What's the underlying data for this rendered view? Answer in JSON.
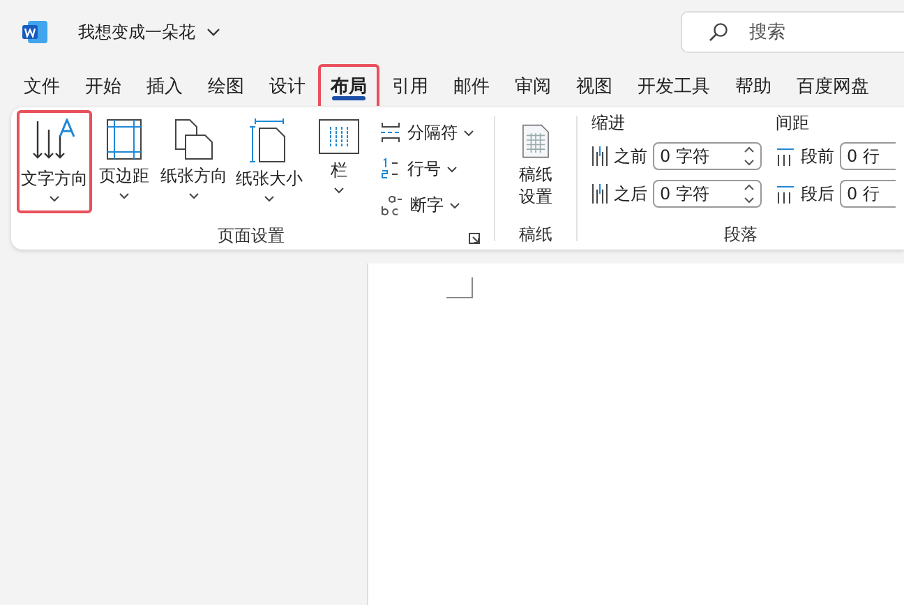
{
  "title_bar": {
    "document_title": "我想变成一朵花",
    "search": {
      "placeholder": "搜索"
    }
  },
  "tabs": [
    {
      "label": "文件",
      "selected": false,
      "highlighted": false
    },
    {
      "label": "开始",
      "selected": false,
      "highlighted": false
    },
    {
      "label": "插入",
      "selected": false,
      "highlighted": false
    },
    {
      "label": "绘图",
      "selected": false,
      "highlighted": false
    },
    {
      "label": "设计",
      "selected": false,
      "highlighted": false
    },
    {
      "label": "布局",
      "selected": true,
      "highlighted": true
    },
    {
      "label": "引用",
      "selected": false,
      "highlighted": false
    },
    {
      "label": "邮件",
      "selected": false,
      "highlighted": false
    },
    {
      "label": "审阅",
      "selected": false,
      "highlighted": false
    },
    {
      "label": "视图",
      "selected": false,
      "highlighted": false
    },
    {
      "label": "开发工具",
      "selected": false,
      "highlighted": false
    },
    {
      "label": "帮助",
      "selected": false,
      "highlighted": false
    },
    {
      "label": "百度网盘",
      "selected": false,
      "highlighted": false
    }
  ],
  "page_setup": {
    "label": "页面设置",
    "large_buttons": [
      {
        "label": "文字方向",
        "highlighted": true
      },
      {
        "label": "页边距",
        "highlighted": false
      },
      {
        "label": "纸张方向",
        "highlighted": false
      },
      {
        "label": "纸张大小",
        "highlighted": false
      },
      {
        "label": "栏",
        "highlighted": false
      }
    ],
    "small_buttons": [
      "分隔符",
      "行号",
      "断字"
    ]
  },
  "manuscript": {
    "label": "稿纸",
    "button": "稿纸设置"
  },
  "paragraph": {
    "label": "段落",
    "indent": {
      "heading": "缩进",
      "fields": [
        {
          "label": "之前",
          "value": "0 字符"
        },
        {
          "label": "之后",
          "value": "0 字符"
        }
      ]
    },
    "spacing": {
      "heading": "间距",
      "fields": [
        {
          "label": "段前",
          "value": "0 行"
        },
        {
          "label": "段后",
          "value": "0 行"
        }
      ]
    }
  }
}
